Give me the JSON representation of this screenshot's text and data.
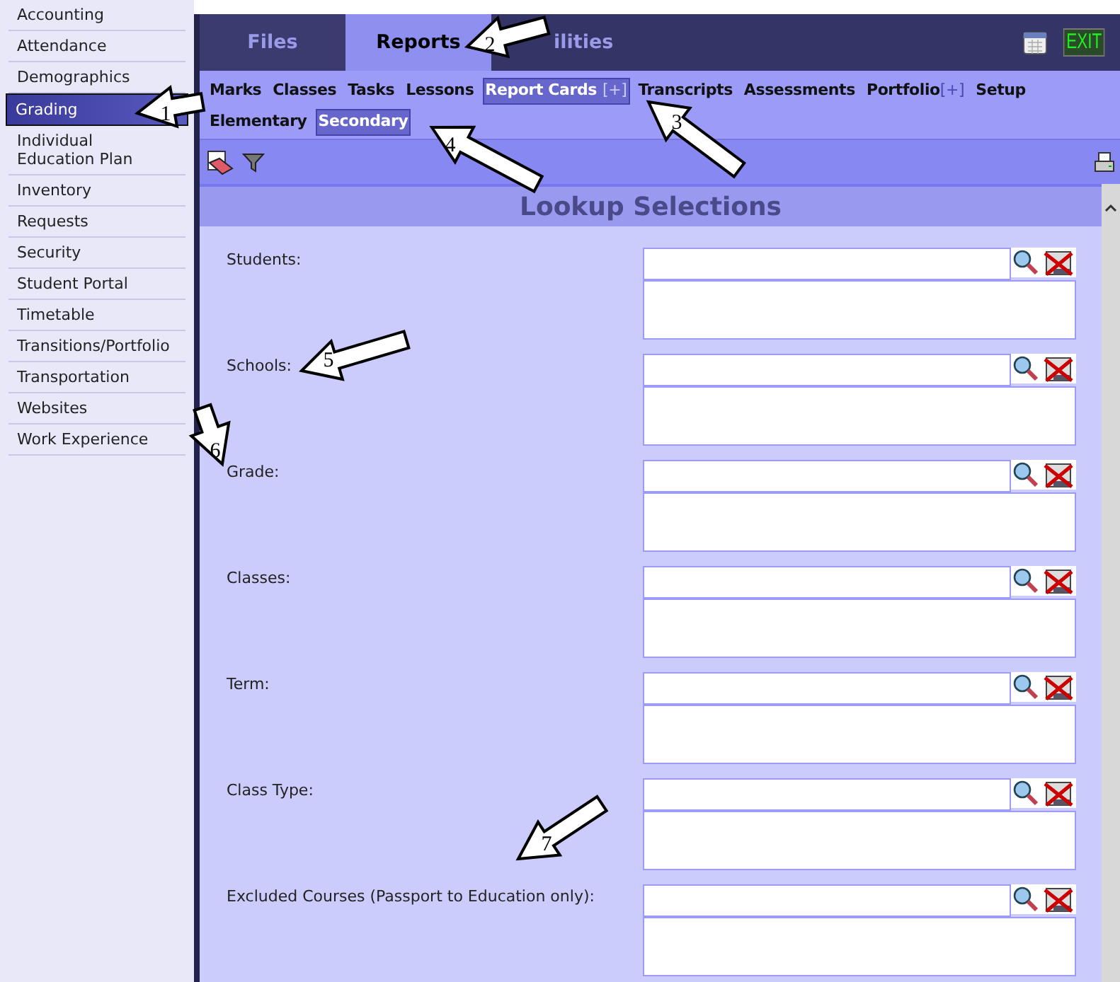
{
  "sidebar": {
    "items": [
      {
        "label": "Accounting",
        "selected": false
      },
      {
        "label": "Attendance",
        "selected": false
      },
      {
        "label": "Demographics",
        "selected": false
      },
      {
        "label": "Grading",
        "selected": true
      },
      {
        "label": "Individual Education Plan",
        "selected": false
      },
      {
        "label": "Inventory",
        "selected": false
      },
      {
        "label": "Requests",
        "selected": false
      },
      {
        "label": "Security",
        "selected": false
      },
      {
        "label": "Student Portal",
        "selected": false
      },
      {
        "label": "Timetable",
        "selected": false
      },
      {
        "label": "Transitions/Portfolio",
        "selected": false
      },
      {
        "label": "Transportation",
        "selected": false
      },
      {
        "label": "Websites",
        "selected": false
      },
      {
        "label": "Work Experience",
        "selected": false
      }
    ]
  },
  "tabs": [
    {
      "label": "Files",
      "selected": false
    },
    {
      "label": "Reports",
      "selected": true
    },
    {
      "label": "ilities",
      "selected": false
    }
  ],
  "exit_label": "EXIT",
  "subnav": [
    [
      {
        "label": "Marks",
        "selected": false
      },
      {
        "label": "Classes",
        "selected": false
      },
      {
        "label": "Tasks",
        "selected": false
      },
      {
        "label": "Lessons",
        "selected": false
      },
      {
        "label": "Report Cards",
        "suffix": "[+]",
        "selected": true
      },
      {
        "label": "Transcripts",
        "selected": false
      },
      {
        "label": "Assessments",
        "selected": false
      },
      {
        "label": "Portfolio",
        "suffix": "[+]",
        "selected": false
      },
      {
        "label": "Setup",
        "selected": false
      }
    ],
    [
      {
        "label": "Elementary",
        "selected": false
      },
      {
        "label": "Secondary",
        "selected": true
      }
    ]
  ],
  "panel_title": "Lookup Selections",
  "fields": [
    {
      "label": "Students:"
    },
    {
      "label": "Schools:"
    },
    {
      "label": "Grade:"
    },
    {
      "label": "Classes:"
    },
    {
      "label": "Term:"
    },
    {
      "label": "Class Type:"
    },
    {
      "label": "Excluded Courses (Passport to Education only):"
    }
  ],
  "callouts": [
    {
      "number": "1"
    },
    {
      "number": "2"
    },
    {
      "number": "3"
    },
    {
      "number": "4"
    },
    {
      "number": "5"
    },
    {
      "number": "6"
    },
    {
      "number": "7"
    }
  ]
}
